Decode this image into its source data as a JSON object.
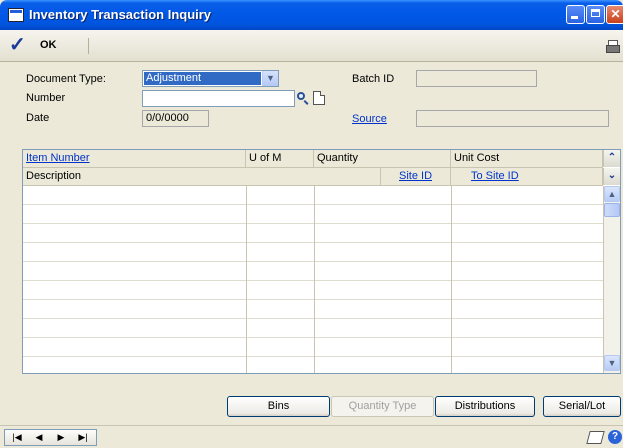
{
  "window": {
    "title": "Inventory Transaction Inquiry"
  },
  "toolbar": {
    "ok_label": "OK"
  },
  "form": {
    "document_type_label": "Document Type:",
    "document_type_value": "Adjustment",
    "number_label": "Number",
    "number_value": "",
    "date_label": "Date",
    "date_value": "0/0/0000",
    "batch_id_label": "Batch ID",
    "batch_id_value": "",
    "source_label": "Source",
    "source_value": ""
  },
  "grid": {
    "header_row1": [
      "Item Number",
      "U of M",
      "Quantity",
      "Unit Cost"
    ],
    "header_row2": [
      "Description",
      "Site ID",
      "To Site ID"
    ],
    "row_count": 10
  },
  "buttons": {
    "bins": "Bins",
    "quantity_type": "Quantity Type",
    "distributions": "Distributions",
    "serial_lot": "Serial/Lot"
  },
  "colors": {
    "title_bar": "#0055df",
    "link": "#0033cc",
    "selection": "#316ac5",
    "background": "#ece9d8"
  }
}
